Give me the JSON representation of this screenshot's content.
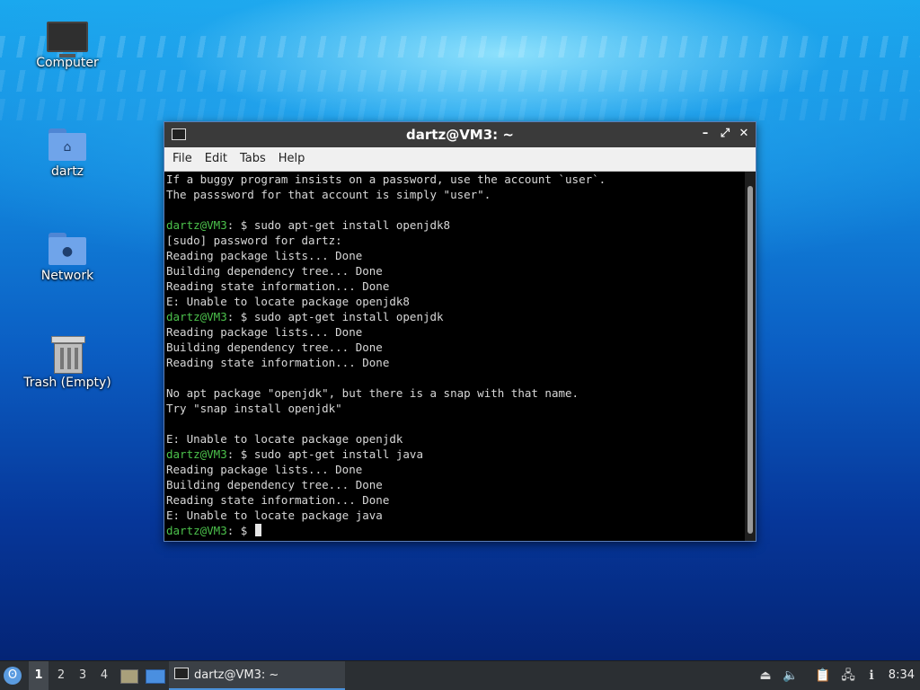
{
  "desktop": {
    "icons": [
      {
        "label": "Computer",
        "icon": "computer-icon"
      },
      {
        "label": "dartz",
        "icon": "home-folder-icon"
      },
      {
        "label": "Network",
        "icon": "network-folder-icon"
      },
      {
        "label": "Trash (Empty)",
        "icon": "trash-icon"
      }
    ]
  },
  "terminal": {
    "title": "dartz@VM3: ~",
    "menu": [
      "File",
      "Edit",
      "Tabs",
      "Help"
    ],
    "controls": {
      "minimize": "–",
      "maximize": "⤢",
      "close": "✕"
    },
    "lines": [
      {
        "text": "If a buggy program insists on a password, use the account `user`."
      },
      {
        "text": "The passsword for that account is simply \"user\"."
      },
      {
        "text": ""
      },
      {
        "prompt": "dartz@VM3",
        "text": ": $ sudo apt-get install openjdk8"
      },
      {
        "text": "[sudo] password for dartz:"
      },
      {
        "text": "Reading package lists... Done"
      },
      {
        "text": "Building dependency tree... Done"
      },
      {
        "text": "Reading state information... Done"
      },
      {
        "text": "E: Unable to locate package openjdk8"
      },
      {
        "prompt": "dartz@VM3",
        "text": ": $ sudo apt-get install openjdk"
      },
      {
        "text": "Reading package lists... Done"
      },
      {
        "text": "Building dependency tree... Done"
      },
      {
        "text": "Reading state information... Done"
      },
      {
        "text": ""
      },
      {
        "text": "No apt package \"openjdk\", but there is a snap with that name."
      },
      {
        "text": "Try \"snap install openjdk\""
      },
      {
        "text": ""
      },
      {
        "text": "E: Unable to locate package openjdk"
      },
      {
        "prompt": "dartz@VM3",
        "text": ": $ sudo apt-get install java"
      },
      {
        "text": "Reading package lists... Done"
      },
      {
        "text": "Building dependency tree... Done"
      },
      {
        "text": "Reading state information... Done"
      },
      {
        "text": "E: Unable to locate package java"
      },
      {
        "prompt": "dartz@VM3",
        "text": ": $ ",
        "cursor": true
      }
    ]
  },
  "taskbar": {
    "workspaces": [
      "1",
      "2",
      "3",
      "4"
    ],
    "active_workspace": "1",
    "task_label": "dartz@VM3: ~",
    "tray_icons": [
      "eject-icon",
      "volume-icon",
      "clipboard-icon",
      "network-icon",
      "update-notifier-icon"
    ],
    "clock": "8:34"
  }
}
